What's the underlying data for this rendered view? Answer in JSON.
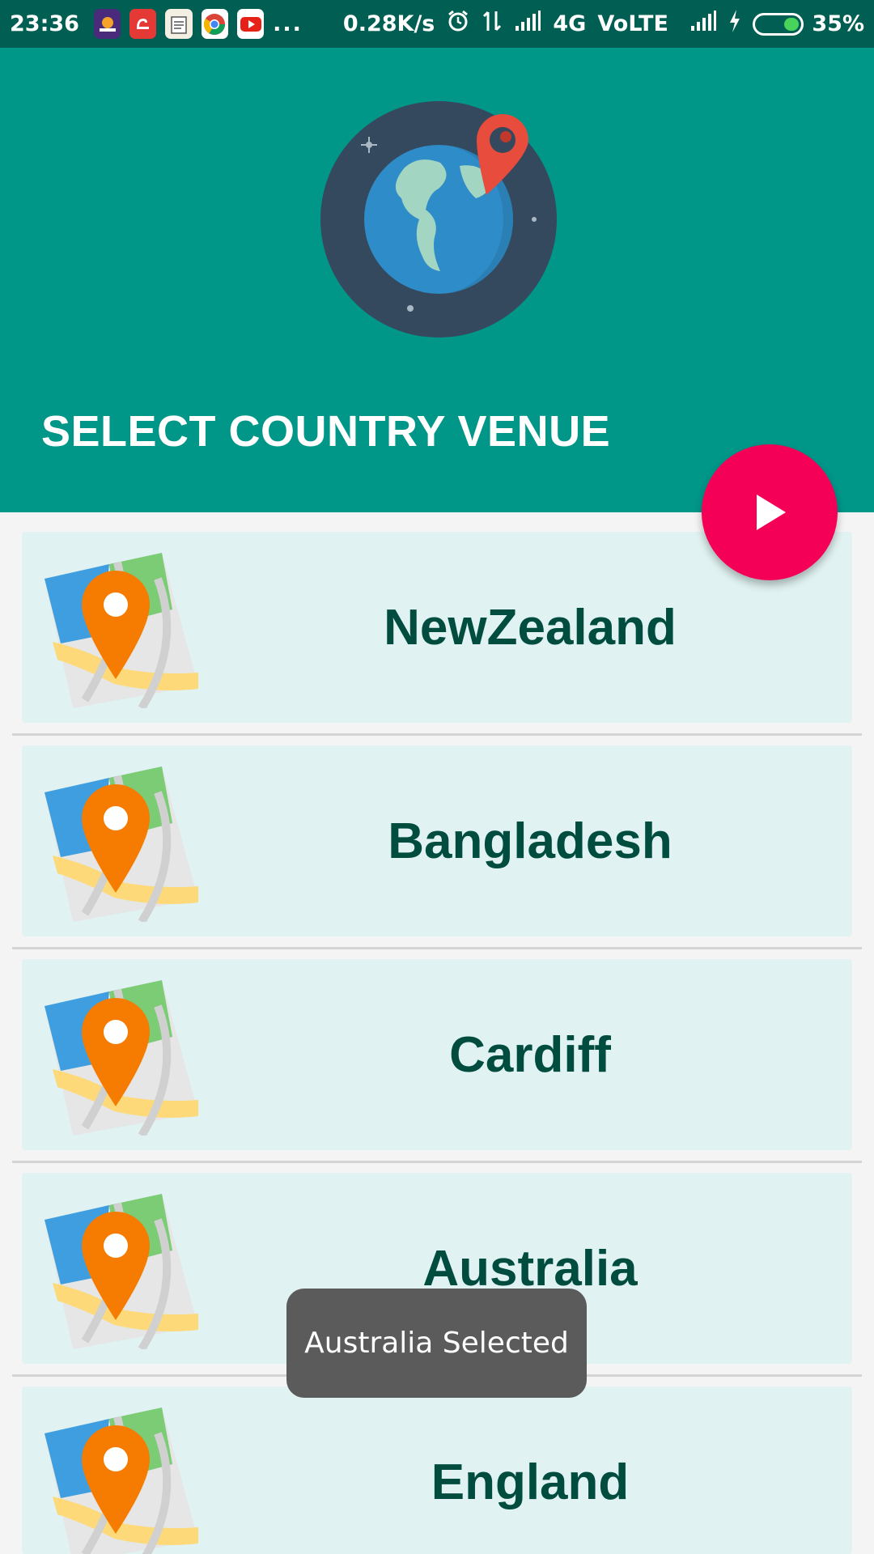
{
  "status_bar": {
    "time": "23:36",
    "app_icons": [
      "josh-app-icon",
      "fitness-app-icon",
      "notes-app-icon",
      "chrome-icon",
      "youtube-icon"
    ],
    "overflow": "...",
    "speed": "0.28K/s",
    "network": "4G",
    "volte": "VoLTE",
    "battery": "35%",
    "battery_level": 0.35
  },
  "header": {
    "title": "SELECT COUNTRY VENUE",
    "background": "#009688"
  },
  "fab": {
    "icon": "play-icon",
    "color": "#f50057"
  },
  "venues": [
    {
      "name": "NewZealand"
    },
    {
      "name": "Bangladesh"
    },
    {
      "name": "Cardiff"
    },
    {
      "name": "Australia"
    },
    {
      "name": "England"
    }
  ],
  "toast": {
    "message": "Australia Selected"
  },
  "colors": {
    "card": "#e0f2f1",
    "text": "#004d40",
    "accent": "#009688"
  }
}
